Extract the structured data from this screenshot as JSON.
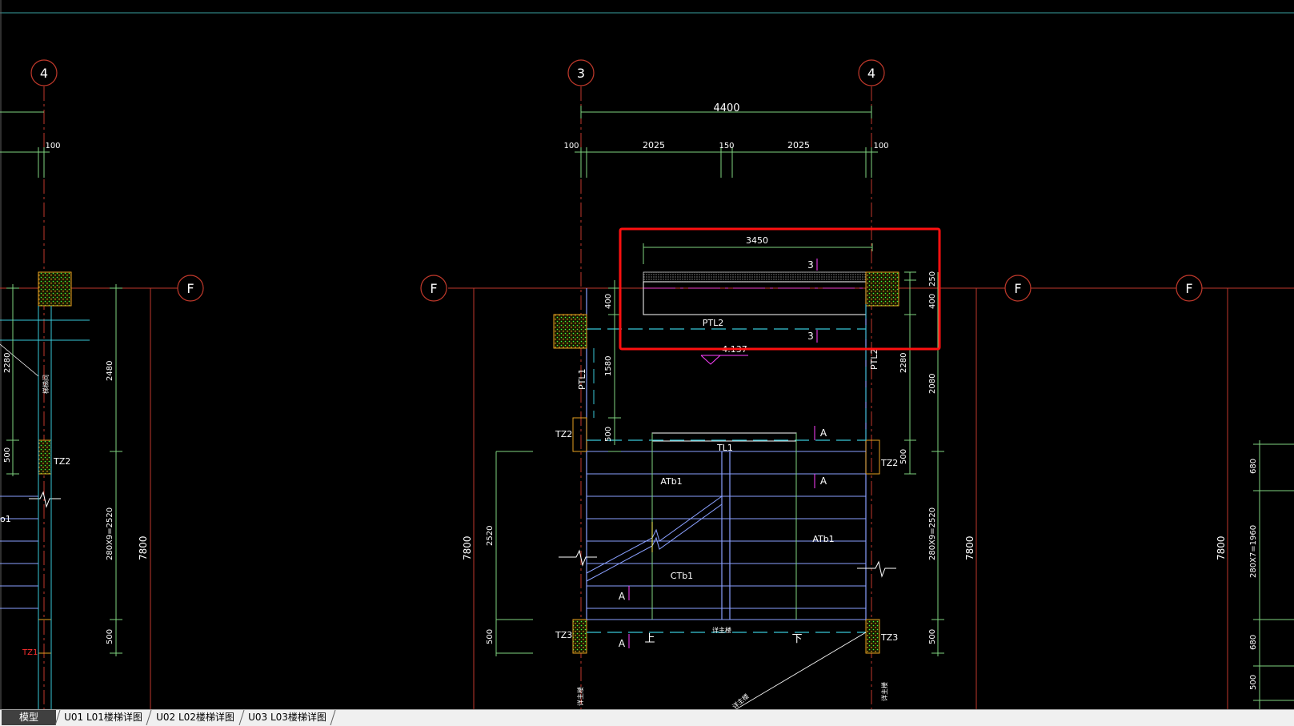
{
  "drawing": {
    "grid_bubbles": {
      "col_4_left": "4",
      "col_3": "3",
      "col_4_right": "4",
      "row_f_1": "F",
      "row_f_2": "F",
      "row_f_3": "F",
      "row_f_4": "F"
    },
    "dimensions": {
      "d4400": "4400",
      "d100_a": "100",
      "d100_b": "100",
      "d100_c": "100",
      "d2025_a": "2025",
      "d150": "150",
      "d2025_b": "2025",
      "d3450": "3450",
      "d400_a": "400",
      "d1580": "1580",
      "d500_a": "500",
      "d2520_left": "2520",
      "d500_b": "500",
      "d7800_mid": "7800",
      "d250": "250",
      "d400_b": "400",
      "d2280_r": "2280",
      "d500_r": "500",
      "d2080": "2080",
      "d280x9_r": "280X9=2520",
      "d500_r2": "500",
      "d7800_r": "7800",
      "d7800_far": "7800",
      "d680_a": "680",
      "d280x7": "280X7=1960",
      "d680_b": "680",
      "d500_far": "500",
      "d2280_l": "2280",
      "d2480": "2480",
      "d500_l": "500",
      "d280x9_l": "280X9=2520",
      "d7800_l": "7800",
      "d500_l2": "500"
    },
    "labels": {
      "ptl2_h": "PTL2",
      "ptl2_v": "PTL2",
      "ptl1": "PTL1",
      "tz2_a": "TZ2",
      "tz2_b": "TZ2",
      "tz2_c": "TZ2",
      "tz3_a": "TZ3",
      "tz3_b": "TZ3",
      "tz1": "TZ1",
      "tl1": "TL1",
      "atb1_a": "ATb1",
      "atb1_b": "ATb1",
      "ctb1": "CTb1",
      "a1": "A",
      "a2": "A",
      "a3": "A",
      "a4": "A",
      "n3_top": "3",
      "n3_bot": "3",
      "elev": "4.137",
      "up": "上",
      "down": "下",
      "wall_note_1": "梯梯间",
      "wall_note_2": "详主楼",
      "wall_note_3": "详主楼",
      "wall_note_4": "详主楼",
      "wall_note_5": "详主楼",
      "bl_partial": "o1"
    }
  },
  "tabs": [
    {
      "label": "模型",
      "active": true
    },
    {
      "label": "U01 L01楼梯详图",
      "active": false
    },
    {
      "label": "U02 L02楼梯详图",
      "active": false
    },
    {
      "label": "U03 L03楼梯详图",
      "active": false
    }
  ],
  "colors": {
    "background": "#000000",
    "grid_red": "#c0392b",
    "dim_green": "#7fd37f",
    "stair_blue": "#8aa0ff",
    "beam_cyan": "#38c8d8",
    "text_white": "#ffffff",
    "magenta": "#ff40ff",
    "highlight_red": "#ff1010",
    "hatch": "#e6a020"
  }
}
